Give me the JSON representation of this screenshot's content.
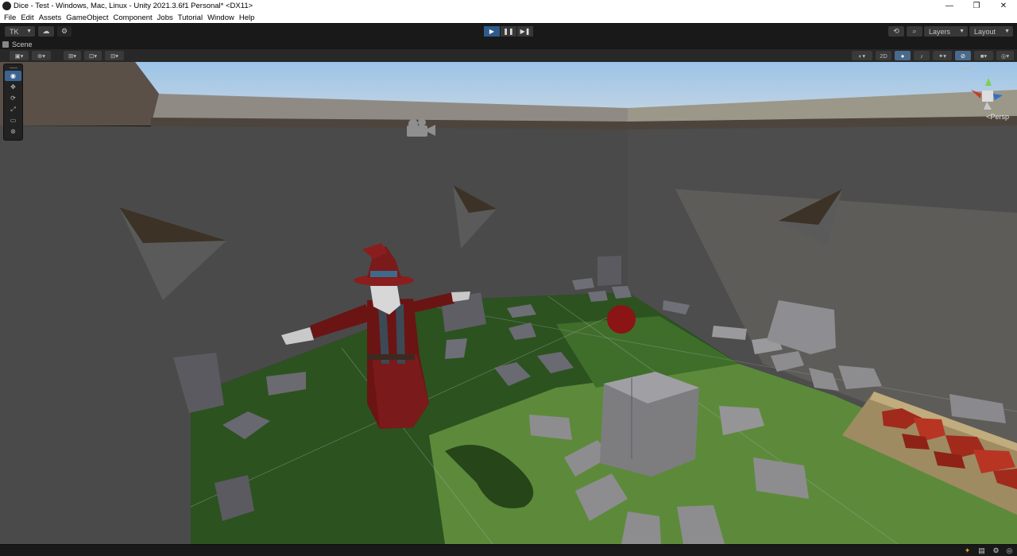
{
  "window": {
    "title": "Dice - Test - Windows, Mac, Linux - Unity 2021.3.6f1 Personal* <DX11>",
    "minimize": "—",
    "restore": "❐",
    "close": "✕"
  },
  "menu": [
    "File",
    "Edit",
    "Assets",
    "GameObject",
    "Component",
    "Jobs",
    "Tutorial",
    "Window",
    "Help"
  ],
  "toolbar": {
    "account": "TK",
    "play": "▶",
    "pause": "❚❚",
    "step": "▶❚",
    "layers": "Layers",
    "layout": "Layout"
  },
  "scene_tab": {
    "label": "Scene"
  },
  "scene_tools": {
    "two_d": "2D"
  },
  "scene_view": {
    "persp_label": "<Persp",
    "gizmo_z": "z",
    "gizmo_x": "x"
  },
  "icons": [
    "unity-logo-icon",
    "cloud-icon",
    "settings-icon",
    "history-icon",
    "search-icon",
    "eye-icon",
    "move-icon",
    "rotate-icon",
    "scale-icon",
    "rect-icon",
    "transform-icon",
    "light-icon",
    "audio-icon",
    "camera-icon",
    "gizmo-icon"
  ],
  "colors": {
    "play_active": "#2e5a8c",
    "tool_active": "#3d6491",
    "sky_top": "#9fc4e4",
    "grass": "#2f5d22"
  }
}
